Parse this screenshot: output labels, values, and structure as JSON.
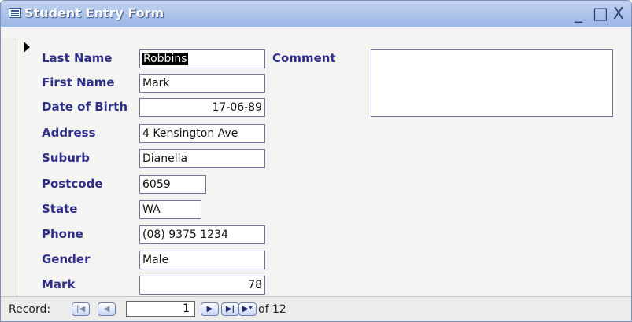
{
  "window": {
    "title": "Student Entry Form",
    "minimize_label": "_",
    "maximize_label": "□",
    "close_label": "X"
  },
  "labels": {
    "last_name": "Last Name",
    "first_name": "First Name",
    "date_of_birth": "Date of Birth",
    "address": "Address",
    "suburb": "Suburb",
    "postcode": "Postcode",
    "state": "State",
    "phone": "Phone",
    "gender": "Gender",
    "mark": "Mark",
    "comment": "Comment"
  },
  "values": {
    "last_name": "Robbins",
    "first_name": "Mark",
    "date_of_birth": "17-06-89",
    "address": "4 Kensington Ave",
    "suburb": "Dianella",
    "postcode": "6059",
    "state": "WA",
    "phone": "(08) 9375 1234",
    "gender": "Male",
    "mark": "78",
    "comment": ""
  },
  "navigation": {
    "label": "Record:",
    "current_record": "1",
    "count_text": "of 12",
    "first_icon": "first-record-icon",
    "previous_icon": "previous-record-icon",
    "next_icon": "next-record-icon",
    "last_icon": "last-record-icon",
    "new_icon": "new-record-icon",
    "first_symbol": "|◀",
    "previous_symbol": "◀",
    "next_symbol": "▶",
    "last_symbol": "▶|",
    "new_symbol": "▶*"
  },
  "colors": {
    "label": "#2f2f8a",
    "titlebar": "#aec4ea",
    "field_border": "#74729a"
  }
}
